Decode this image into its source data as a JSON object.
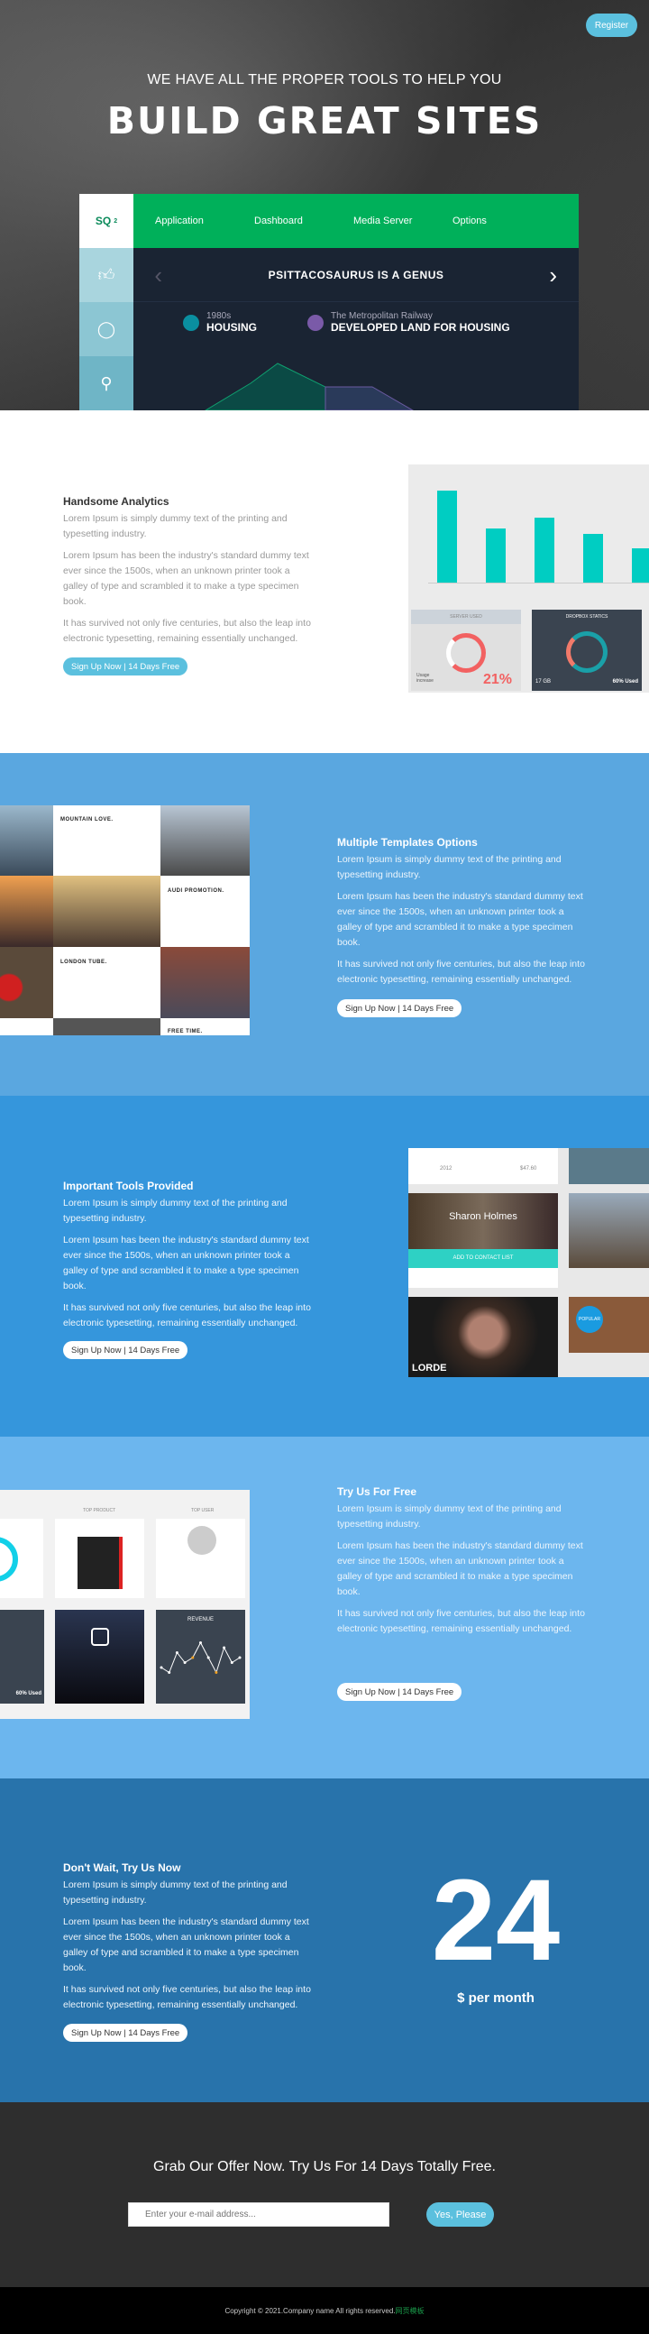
{
  "hero": {
    "register_label": "Register",
    "subtitle": "WE HAVE ALL THE PROPER TOOLS TO HELP YOU",
    "title": "BUILD GREAT SITES",
    "panel": {
      "logo": "SQ",
      "logo_sup": "2",
      "nav": [
        "Application",
        "Dashboard",
        "Media Server",
        "Options"
      ],
      "slide_title": "PSITTACOSAURUS IS A GENUS",
      "legend": [
        {
          "small": "1980s",
          "big": "HOUSING",
          "color": "#0a8fa0"
        },
        {
          "small": "The Metropolitan Railway",
          "big": "DEVELOPED LAND FOR HOUSING",
          "color": "#7a5aa8"
        }
      ],
      "side_icons": [
        "thumbs-up-icon",
        "chat-bubble-icon",
        "search-icon"
      ],
      "colors": {
        "nav": "#00b05a",
        "dark": "#1a2433"
      }
    }
  },
  "cta_label": "Sign Up Now | 14 Days Free",
  "analytics": {
    "heading": "Handsome Analytics",
    "p1": "Lorem Ipsum is simply dummy text of the printing and typesetting industry.",
    "p2": "Lorem Ipsum has been the industry's standard dummy text ever since the 1500s, when an unknown printer took a galley of type and scrambled it to make a type specimen book.",
    "p3": "It has survived not only five centuries, but also the leap into electronic typesetting, remaining essentially unchanged.",
    "dashboard": {
      "bars": [
        8500,
        5000,
        6000,
        4500,
        3200
      ],
      "server_title": "SERVER USED",
      "usage_label": "Usage increase",
      "usage_value": "21%",
      "dropbox_title": "DROPBOX STATICS",
      "storage": "17 GB",
      "used": "60% Used"
    }
  },
  "templates": {
    "heading": "Multiple Templates Options",
    "p1": "Lorem Ipsum is simply dummy text of the printing and typesetting industry.",
    "p2": "Lorem Ipsum has been the industry's standard dummy text ever since the 1500s, when an unknown printer took a galley of type and scrambled it to make a type specimen book.",
    "p3": "It has survived not only five centuries, but also the leap into electronic typesetting, remaining essentially unchanged.",
    "cards": [
      "MOUNTAIN LOVE.",
      "AUDI PROMOTION.",
      "LONDON TUBE.",
      "FREE TIME."
    ]
  },
  "tools": {
    "heading": "Important Tools Provided",
    "p1": "Lorem Ipsum is simply dummy text of the printing and typesetting industry.",
    "p2": "Lorem Ipsum has been the industry's standard dummy text ever since the 1500s, when an unknown printer took a galley of type and scrambled it to make a type specimen book.",
    "p3": "It has survived not only five centuries, but also the leap into electronic typesetting, remaining essentially unchanged.",
    "profile_name": "Sharon Holmes",
    "add_contact": "ADD TO CONTACT LIST",
    "artist": "LORDE",
    "popular": "POPULAR",
    "stat1": "2012",
    "stat2": "$47.60"
  },
  "free": {
    "heading": "Try Us For Free",
    "p1": "Lorem Ipsum is simply dummy text of the printing and typesetting industry.",
    "p2": "Lorem Ipsum has been the industry's standard dummy text ever since the 1500s, when an unknown printer took a galley of type and scrambled it to make a type specimen book.",
    "p3": "It has survived not only five centuries, but also the leap into electronic typesetting, remaining essentially unchanged.",
    "top_product": "TOP PRODUCT",
    "top_user": "TOP USER",
    "revenue": "REVENUE",
    "used": "60% Used",
    "revenue_series": [
      2,
      1,
      5,
      3,
      4,
      7,
      4,
      1,
      6,
      3,
      4
    ]
  },
  "pricing": {
    "heading": "Don't Wait, Try Us Now",
    "p1": "Lorem Ipsum is simply dummy text of the printing and typesetting industry.",
    "p2": "Lorem Ipsum has been the industry's standard dummy text ever since the 1500s, when an unknown printer took a galley of type and scrambled it to make a type specimen book.",
    "p3": "It has survived not only five centuries, but also the leap into electronic typesetting, remaining essentially unchanged.",
    "price": "24",
    "per": "$ per month"
  },
  "offer": {
    "heading": "Grab Our Offer Now. Try Us For 14 Days Totally Free.",
    "email_placeholder": "Enter your e-mail address...",
    "submit_label": "Yes, Please"
  },
  "footer": {
    "copyright": "Copyright © 2021.Company name All rights reserved.",
    "link": "网页模板"
  },
  "colors": {
    "accent": "#5bc0de",
    "blue1": "#5aa7e0",
    "blue2": "#3596dc",
    "blue3": "#6cb6ee",
    "blue4": "#2873ab",
    "dark": "#2e2e2e",
    "teal": "#00cdc2"
  }
}
